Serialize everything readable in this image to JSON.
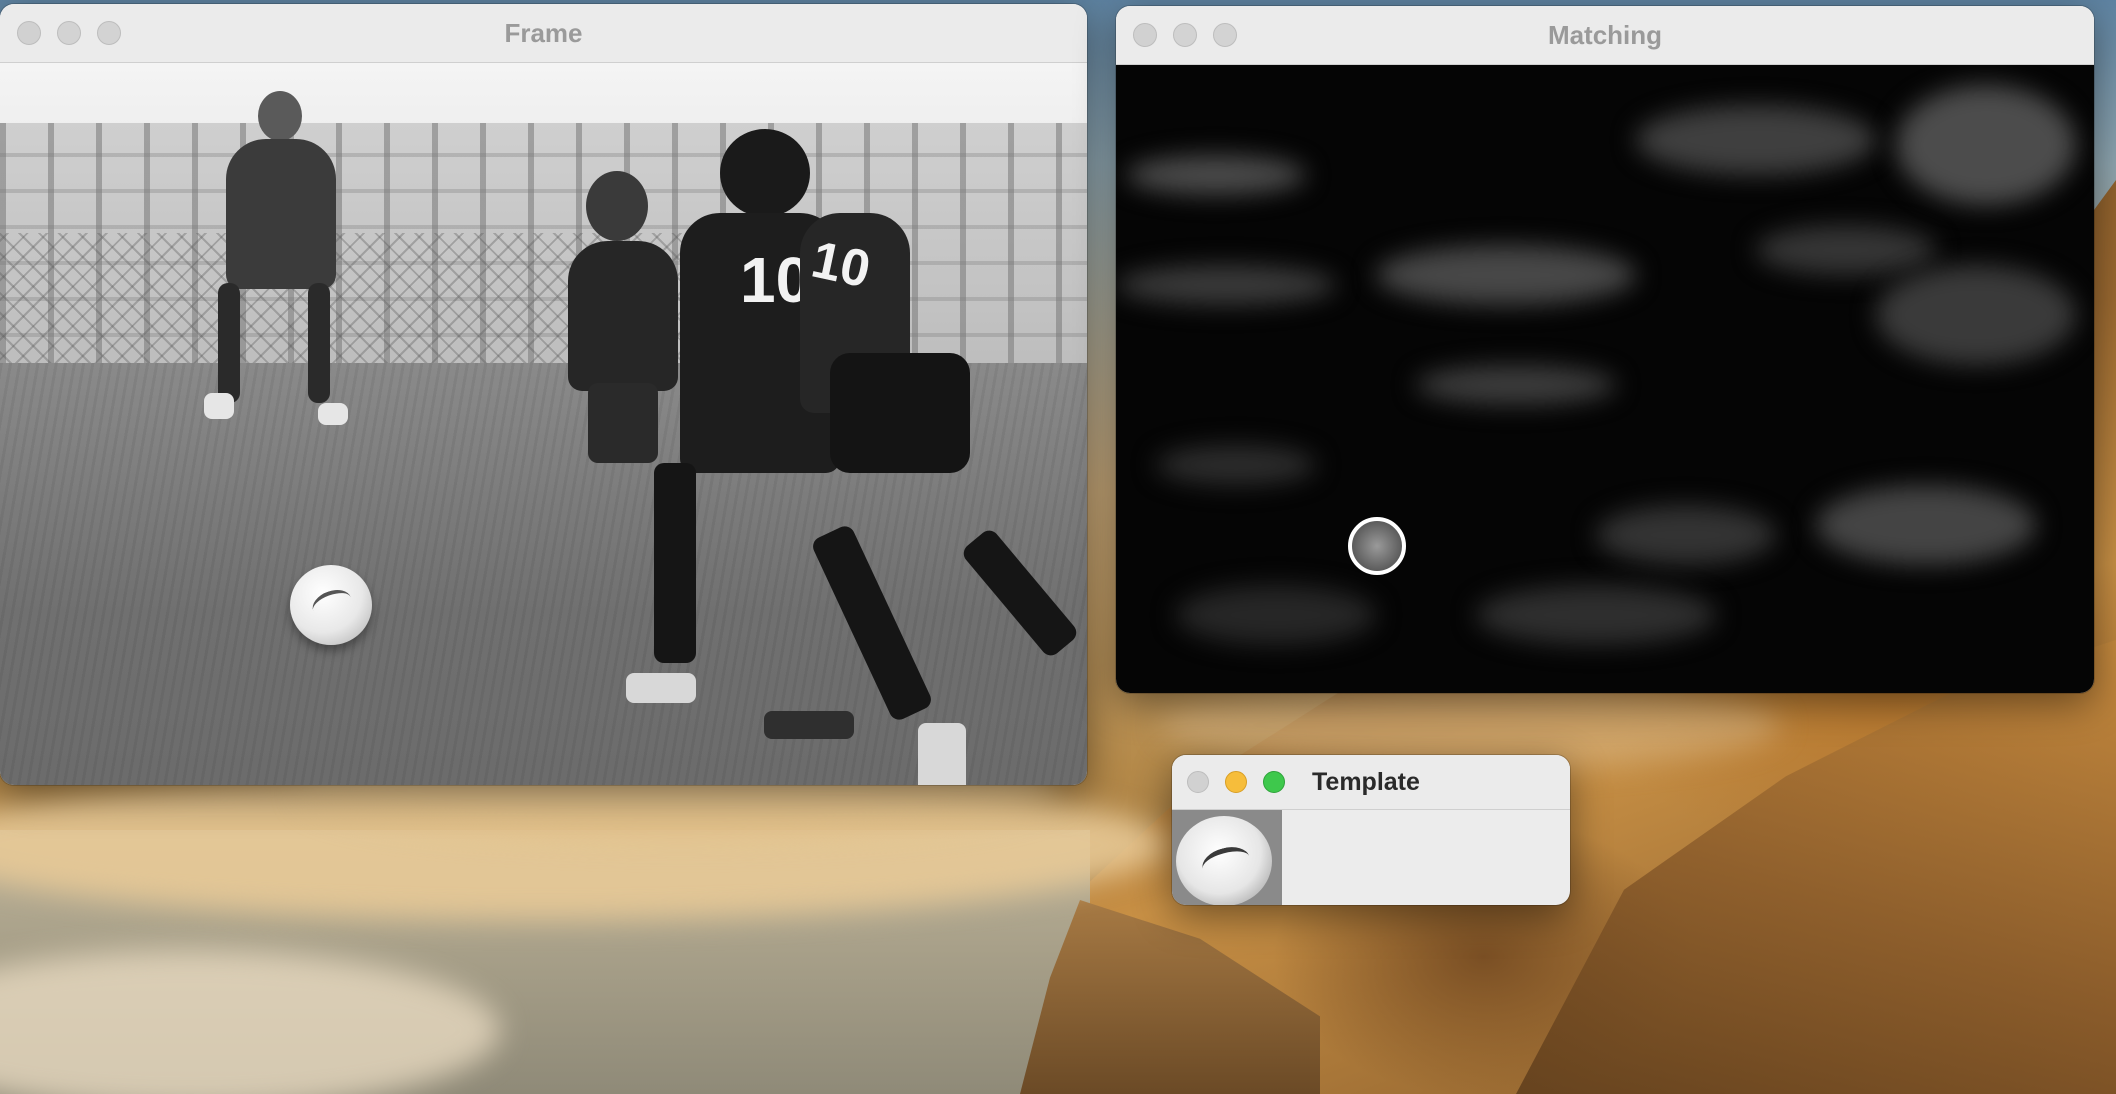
{
  "windows": {
    "frame": {
      "title": "Frame",
      "image": "grayscale video frame of youth soccer players chasing a ball",
      "jersey_numbers": [
        "10",
        "10"
      ]
    },
    "matching": {
      "title": "Matching",
      "image": "template matching response heatmap",
      "marker": "white circle marking best match location"
    },
    "template": {
      "title": "Template",
      "image": "cropped soccer ball template"
    }
  },
  "colors": {
    "close_light": "#d1d1d1",
    "minimize_light": "#f6bd3b",
    "zoom_light": "#3ec84c",
    "inactive_title": "#9a9a9a",
    "active_title": "#2a2a2a"
  }
}
